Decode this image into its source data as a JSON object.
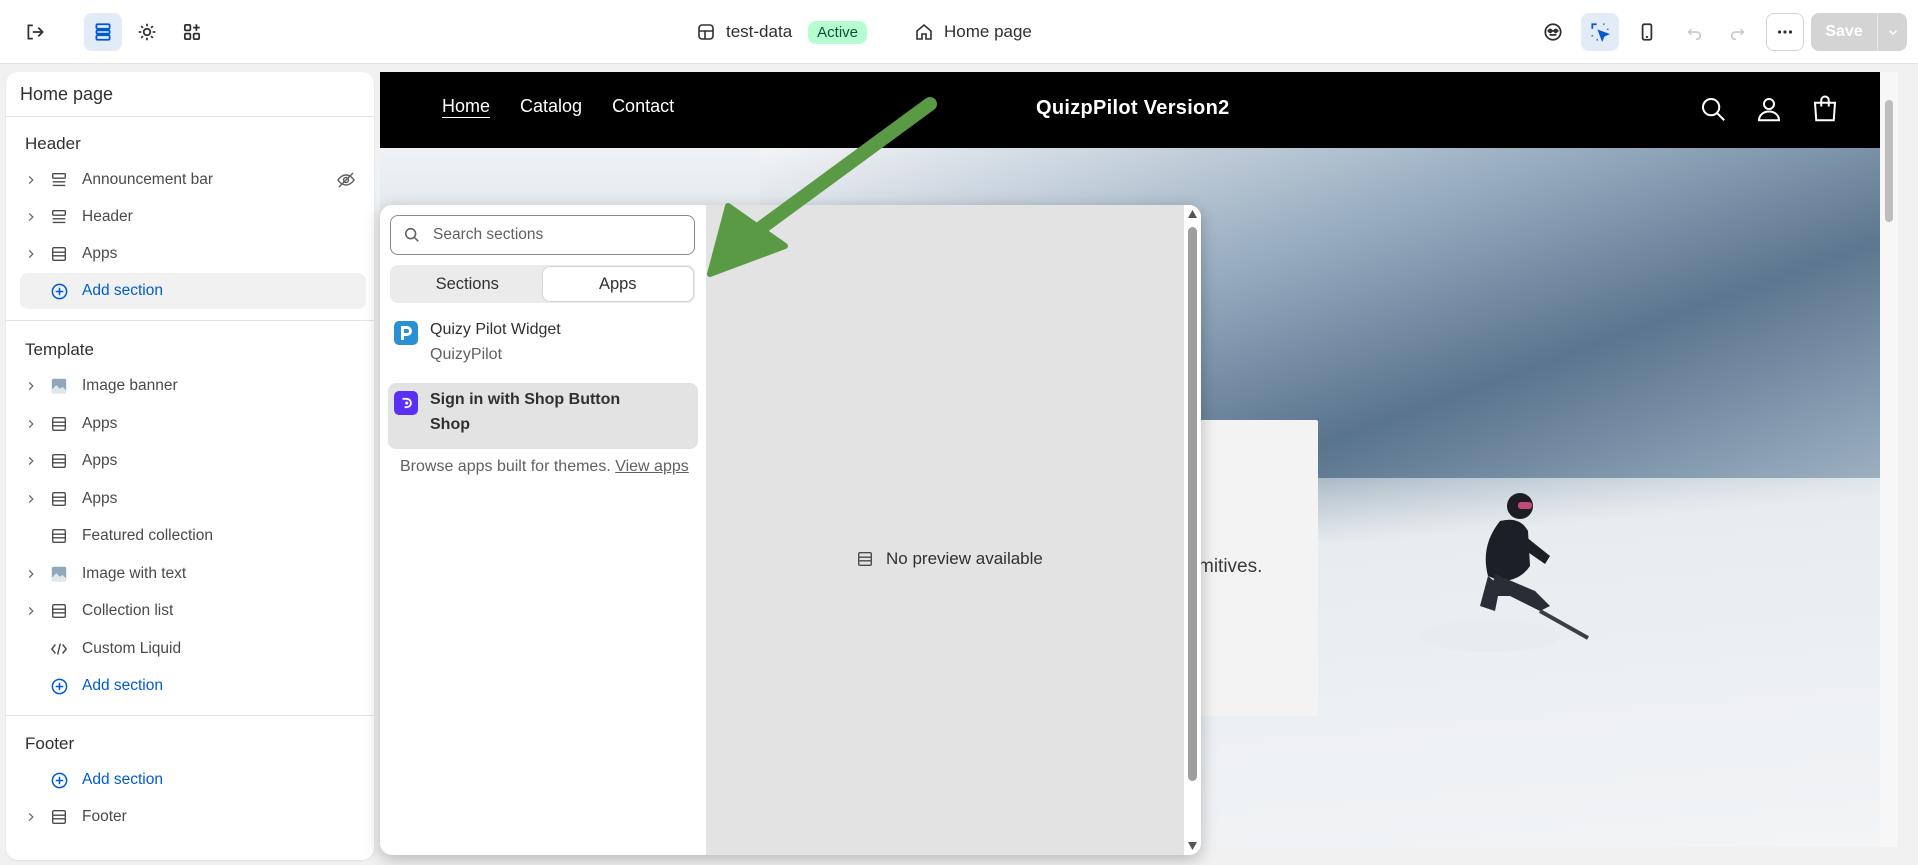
{
  "topbar": {
    "store_name": "test-data",
    "store_status": "Active",
    "page_name": "Home page",
    "save_label": "Save"
  },
  "sidebar": {
    "title": "Home page",
    "groups": [
      {
        "title": "Header",
        "items": [
          {
            "label": "Announcement bar",
            "icon": "section-icon",
            "hidden": true
          },
          {
            "label": "Header",
            "icon": "section-icon"
          },
          {
            "label": "Apps",
            "icon": "apps-section-icon"
          },
          {
            "label": "Add section",
            "icon": "plus-circle-icon",
            "add": true
          }
        ]
      },
      {
        "title": "Template",
        "items": [
          {
            "label": "Image banner",
            "icon": "image-icon"
          },
          {
            "label": "Apps",
            "icon": "apps-section-icon"
          },
          {
            "label": "Apps",
            "icon": "apps-section-icon"
          },
          {
            "label": "Apps",
            "icon": "apps-section-icon"
          },
          {
            "label": "Featured collection",
            "icon": "apps-section-icon"
          },
          {
            "label": "Image with text",
            "icon": "image-icon"
          },
          {
            "label": "Collection list",
            "icon": "apps-section-icon"
          },
          {
            "label": "Custom Liquid",
            "icon": "code-icon"
          },
          {
            "label": "Add section",
            "icon": "plus-circle-icon",
            "add": true
          }
        ]
      },
      {
        "title": "Footer",
        "items": [
          {
            "label": "Add section",
            "icon": "plus-circle-icon",
            "add": true
          },
          {
            "label": "Footer",
            "icon": "apps-section-icon"
          }
        ]
      }
    ]
  },
  "store": {
    "nav": [
      "Home",
      "Catalog",
      "Contact"
    ],
    "title": "QuizpPilot Version2",
    "banner_text": "mitives."
  },
  "picker": {
    "search_placeholder": "Search sections",
    "tabs": [
      "Sections",
      "Apps"
    ],
    "active_tab": "Apps",
    "apps": [
      {
        "name": "Quizy Pilot Widget",
        "vendor": "QuizyPilot",
        "logo_color": "#2b8fd6",
        "logo_letter": "P"
      },
      {
        "name": "Sign in with Shop Button",
        "vendor": "Shop",
        "logo_color": "#5a31f4",
        "logo_letter": "S",
        "selected": true
      }
    ],
    "browse_text": "Browse apps built for themes.",
    "browse_link": "View apps",
    "no_preview": "No preview available"
  },
  "colors": {
    "accent": "#005bd3",
    "active_badge_bg": "#b4fed2",
    "annotation_arrow": "#5a9a45"
  }
}
